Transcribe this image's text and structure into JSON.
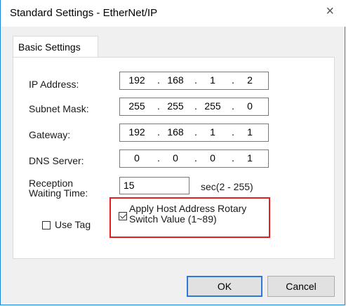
{
  "window": {
    "title": "Standard Settings - EtherNet/IP",
    "close_glyph": "×"
  },
  "tabs": [
    {
      "label": "Basic Settings"
    }
  ],
  "fields": {
    "ip_address": {
      "label": "IP Address:",
      "octets": [
        "192",
        "168",
        "1",
        "2"
      ]
    },
    "subnet_mask": {
      "label": "Subnet Mask:",
      "octets": [
        "255",
        "255",
        "255",
        "0"
      ]
    },
    "gateway": {
      "label": "Gateway:",
      "octets": [
        "192",
        "168",
        "1",
        "1"
      ]
    },
    "dns_server": {
      "label": "DNS Server:",
      "octets": [
        "0",
        "0",
        "0",
        "1"
      ]
    },
    "reception_waiting_time": {
      "label_line1": "Reception",
      "label_line2": "Waiting Time:",
      "value": "15",
      "range": "sec(2 - 255)"
    }
  },
  "options": {
    "apply_host_address": {
      "label_line1": "Apply Host Address Rotary",
      "label_line2": "Switch Value (1~89)",
      "checked": true
    },
    "use_tag": {
      "label": "Use Tag",
      "checked": false
    }
  },
  "buttons": {
    "ok": "OK",
    "cancel": "Cancel"
  },
  "colors": {
    "highlight": "#e02020",
    "window_border": "#1883d7",
    "default_button_border": "#2f78d6"
  }
}
